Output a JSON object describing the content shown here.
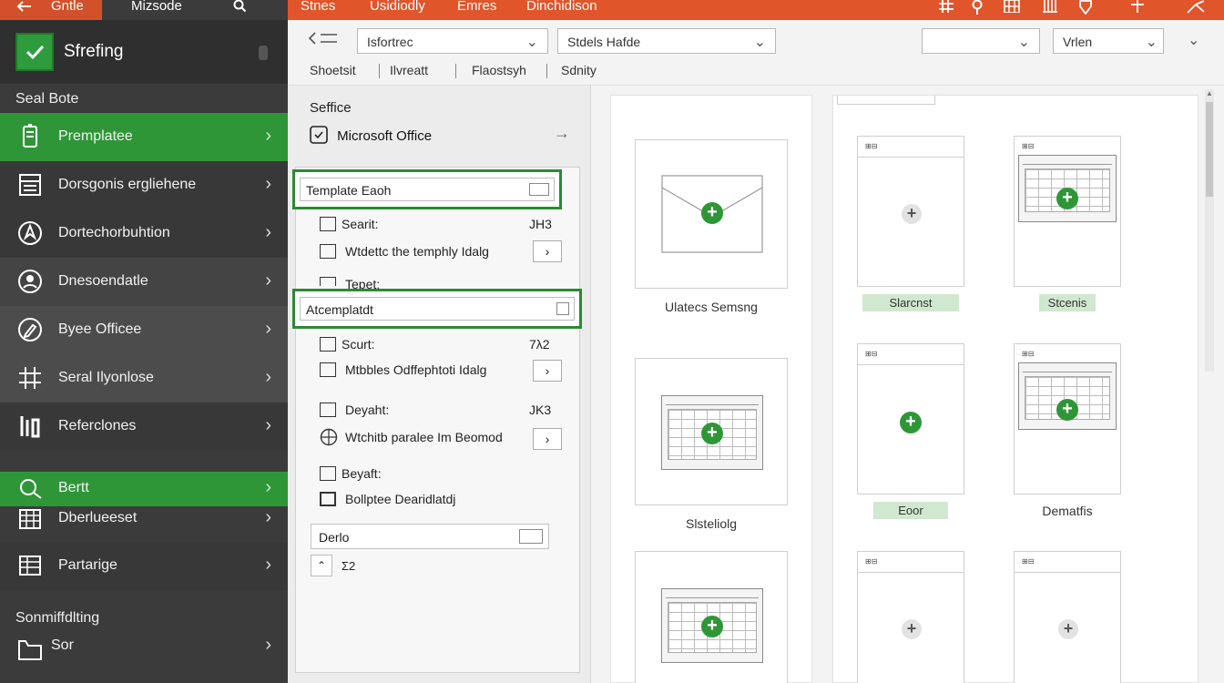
{
  "topbar": {
    "left_items": [
      "Gntle",
      "Mizsode"
    ],
    "right_items": [
      "Stnes",
      "Usidiodly",
      "Emres",
      "Dinchidison"
    ]
  },
  "sidebar": {
    "app_title": "Sfrefing",
    "section1": "Seal Bote",
    "items": [
      {
        "label": "Premplatee",
        "icon": "tablet-icon"
      },
      {
        "label": "Dorsgonis ergliehene",
        "icon": "document-list-icon"
      },
      {
        "label": "Dortechorbuhtion",
        "icon": "compass-icon"
      },
      {
        "label": "Dnesoendatle",
        "icon": "face-icon"
      },
      {
        "label": "Byee Officee",
        "icon": "edit-circle-icon"
      },
      {
        "label": "Seral Ilyonlose",
        "icon": "grid-tool-icon"
      },
      {
        "label": "Referclones",
        "icon": "bars-icon"
      },
      {
        "label": "Bertt",
        "icon": "search-icon"
      },
      {
        "label": "Dberlueeset",
        "icon": "table-icon"
      },
      {
        "label": "Partarige",
        "icon": "sheet-icon"
      }
    ],
    "section2": "Sonmiffdlting",
    "bottom_items": [
      {
        "label": "Sor",
        "icon": "folder-icon"
      }
    ]
  },
  "toolbar": {
    "back_icon": "list-back-icon",
    "select1": "Isfortrec",
    "select2": "Stdels Hafde",
    "select3": "",
    "select4": "Vrlen",
    "links": [
      "Shoetsit",
      "Ilvreatt",
      "Flaostsyh",
      "Sdnity"
    ]
  },
  "middle": {
    "label": "Seffice",
    "office_row": "Microsoft Office",
    "highlight1": "Template Eaoh",
    "row1_label": "Searit:",
    "row1_value": "JH3",
    "row2_label": "Wtdettc the temphly Idalg",
    "row3_label": "Tepet:",
    "highlight2": "Atcemplatdt",
    "row4_label": "Scurt:",
    "row4_value": "7λ2",
    "row5_label": "Mtbbles Odffephtoti Idalg",
    "row6_label": "Deyaht:",
    "row6_value": "JK3",
    "row7_label": "Wtchitb paralee Im Beomod",
    "row8_label": "Beyaft:",
    "row9_label": "Bollptee Dearidlatdj",
    "bottom_field": "Derlo",
    "small_text": "Σ2"
  },
  "content": {
    "col1_captions": [
      "Ulatecs Semsng",
      "Slsteliolg"
    ],
    "col2_top_strip": "",
    "col2_tags": [
      "Slarcnst",
      "Stcenis",
      "Eoor",
      "Dematfis"
    ]
  },
  "colors": {
    "accent_orange": "#e0552a",
    "accent_green": "#2f9638",
    "sidebar_bg": "#3b3b3b"
  }
}
